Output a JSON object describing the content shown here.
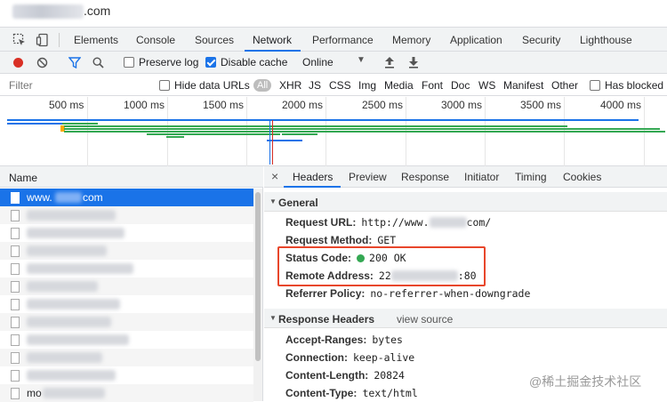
{
  "titlebar": {
    "domain": ".com"
  },
  "devtools_tabs": {
    "items": [
      "Elements",
      "Console",
      "Sources",
      "Network",
      "Performance",
      "Memory",
      "Application",
      "Security",
      "Lighthouse"
    ],
    "active": "Network"
  },
  "toolbar": {
    "preserve_log": "Preserve log",
    "disable_cache": "Disable cache",
    "throttle": "Online",
    "preserve_checked": false,
    "disable_cache_checked": true
  },
  "filterbar": {
    "placeholder": "Filter",
    "hide_data_urls": "Hide data URLs",
    "types": [
      "All",
      "XHR",
      "JS",
      "CSS",
      "Img",
      "Media",
      "Font",
      "Doc",
      "WS",
      "Manifest",
      "Other"
    ],
    "has_blocked": "Has blocked"
  },
  "timeline": {
    "ticks": [
      "500 ms",
      "1000 ms",
      "1500 ms",
      "2000 ms",
      "2500 ms",
      "3000 ms",
      "3500 ms",
      "4000 ms"
    ]
  },
  "request_list": {
    "header": "Name",
    "selected_prefix": "www.",
    "selected_suffix": "com",
    "last_row": "mo"
  },
  "details": {
    "tabs": [
      "Headers",
      "Preview",
      "Response",
      "Initiator",
      "Timing",
      "Cookies"
    ],
    "active_tab": "Headers",
    "close": "×",
    "general": {
      "title": "General",
      "request_url_key": "Request URL:",
      "request_url_prefix": "http://www.",
      "request_url_suffix": "com/",
      "request_method_key": "Request Method:",
      "request_method": "GET",
      "status_code_key": "Status Code:",
      "status_code": "200 OK",
      "remote_address_key": "Remote Address:",
      "remote_address_prefix": "22",
      "remote_address_suffix": ":80",
      "referrer_policy_key": "Referrer Policy:",
      "referrer_policy": "no-referrer-when-downgrade"
    },
    "response_headers": {
      "title": "Response Headers",
      "view_source": "view source",
      "accept_ranges_key": "Accept-Ranges:",
      "accept_ranges": "bytes",
      "connection_key": "Connection:",
      "connection": "keep-alive",
      "content_length_key": "Content-Length:",
      "content_length": "20824",
      "content_type_key": "Content-Type:",
      "content_type": "text/html"
    }
  },
  "watermark": "@稀土掘金技术社区",
  "colors": {
    "accent": "#1a73e8",
    "record": "#d93025",
    "status_ok": "#34a853",
    "highlight": "#e8462b"
  }
}
